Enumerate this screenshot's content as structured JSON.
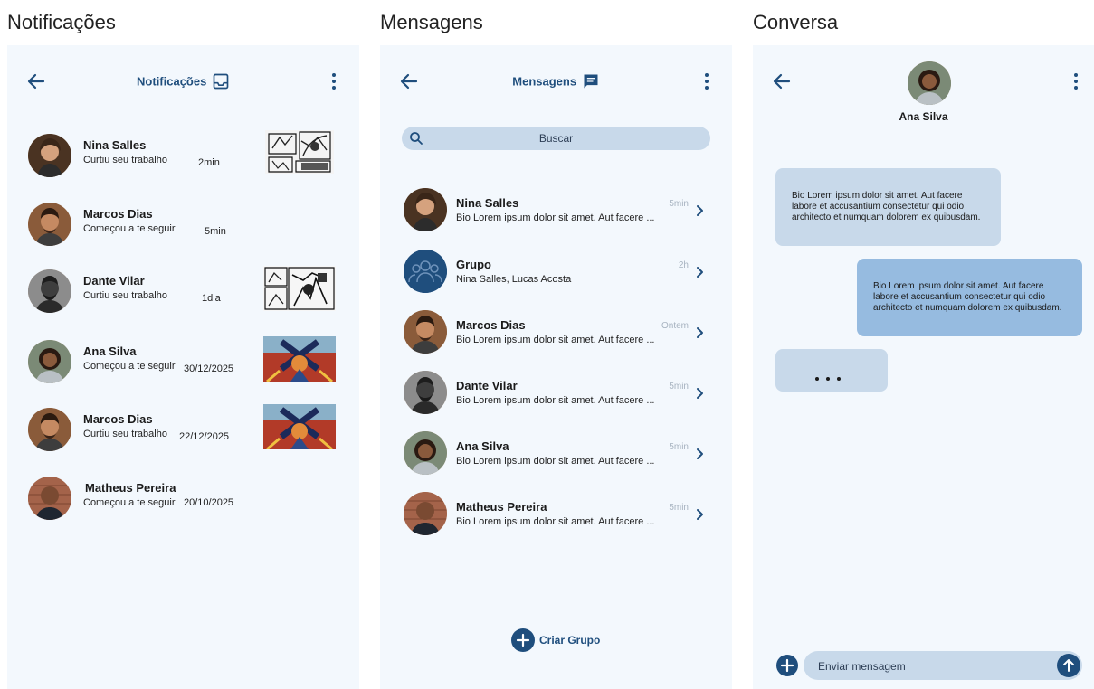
{
  "frames": {
    "notifications": "Notificações",
    "messages": "Mensagens",
    "chat": "Conversa"
  },
  "colors": {
    "accent": "#1f4e7d",
    "background": "#f3f8fd",
    "bubble_in": "#c8d9ea",
    "bubble_out": "#96bbe0"
  },
  "notifications": {
    "title": "Notificações",
    "header_icon": "inbox-icon",
    "items": [
      {
        "name": "Nina Salles",
        "action": "Curtiu seu trabalho",
        "time": "2min",
        "thumb": "manga-bw"
      },
      {
        "name": "Marcos Dias",
        "action": "Começou a te seguir",
        "time": "5min",
        "thumb": ""
      },
      {
        "name": "Dante Vilar",
        "action": "Curtiu seu trabalho",
        "time": "1dia",
        "thumb": "manga-bw"
      },
      {
        "name": "Ana Silva",
        "action": "Começou a te seguir",
        "time": "30/12/2025",
        "thumb": "comic-color"
      },
      {
        "name": "Marcos Dias",
        "action": "Curtiu seu trabalho",
        "time": "22/12/2025",
        "thumb": "comic-color"
      },
      {
        "name": "Matheus Pereira",
        "action": "Começou a te seguir",
        "time": "20/10/2025",
        "thumb": ""
      }
    ]
  },
  "messages": {
    "title": "Mensagens",
    "header_icon": "chat-icon",
    "search_placeholder": "Buscar",
    "items": [
      {
        "name": "Nina Salles",
        "preview": "Bio Lorem ipsum dolor sit amet. Aut facere ...",
        "time": "5min"
      },
      {
        "name": "Grupo",
        "preview": "Nina Salles, Lucas Acosta",
        "time": "2h"
      },
      {
        "name": "Marcos Dias",
        "preview": "Bio Lorem ipsum dolor sit amet. Aut facere ...",
        "time": "Ontem"
      },
      {
        "name": "Dante Vilar",
        "preview": "Bio Lorem ipsum dolor sit amet. Aut facere ...",
        "time": "5min"
      },
      {
        "name": "Ana Silva",
        "preview": "Bio Lorem ipsum dolor sit amet. Aut facere ...",
        "time": "5min"
      },
      {
        "name": "Matheus Pereira",
        "preview": "Bio Lorem ipsum dolor sit amet. Aut facere ...",
        "time": "5min"
      }
    ],
    "create_group": "Criar Grupo"
  },
  "chat": {
    "contact": "Ana Silva",
    "incoming": "Bio Lorem ipsum dolor sit amet. Aut facere labore et accusantium consectetur qui odio architecto et numquam dolorem ex quibusdam.",
    "outgoing": "Bio Lorem ipsum dolor sit amet. Aut facere labore et accusantium consectetur qui odio architecto et numquam dolorem ex quibusdam.",
    "input_placeholder": "Enviar mensagem"
  }
}
